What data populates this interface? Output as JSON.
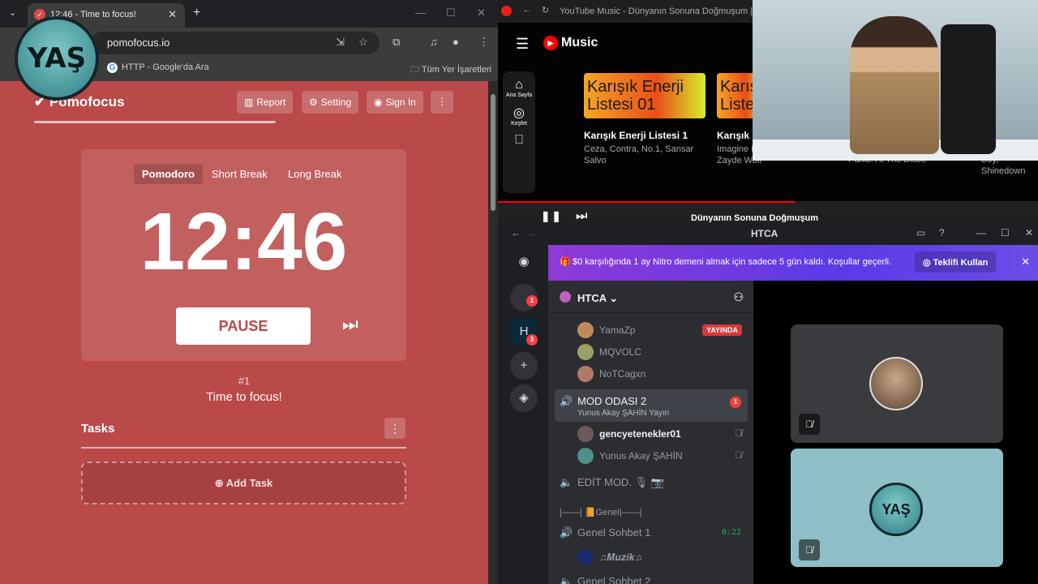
{
  "chrome": {
    "tab_title": "12:46 - Time to focus!",
    "url": "pomofocus.io",
    "bookmark_google": "HTTP - Google'da Ara",
    "bookmark_all": "Tüm Yer İşaretleri",
    "logo_text": "YAŞ"
  },
  "pomofocus": {
    "brand": "Pomofocus",
    "header_buttons": [
      {
        "label": "Report",
        "icon": "chart-icon"
      },
      {
        "label": "Setting",
        "icon": "gear-icon"
      },
      {
        "label": "Sign In",
        "icon": "user-icon"
      }
    ],
    "modes": [
      "Pomodoro",
      "Short Break",
      "Long Break"
    ],
    "active_mode": "Pomodoro",
    "timer": "12:46",
    "pause_label": "PAUSE",
    "round": "#1",
    "focus_text": "Time to focus!",
    "tasks_title": "Tasks",
    "add_task_label": "Add Task",
    "bg_color": "#ba4949"
  },
  "ytmusic": {
    "window_title": "YouTube Music - Dünyanın Sonuna Doğmuşum | YouT",
    "logo": "Music",
    "side_home": "Ana Sayfa",
    "side_explore": "Keşfet",
    "cards": [
      {
        "art_text": "Karışık Enerji Listesi",
        "num": "01",
        "title": "Karışık Enerji Listesi 1",
        "subtitle": "Ceza, Contra, No.1, Sansar Salvo"
      },
      {
        "art_text": "Karışık Listesi",
        "num": "",
        "title": "Karışık E",
        "subtitle": "Imagine Boy, Skillet, Zayde Wolf"
      }
    ],
    "extra_sub_1": "Panic! At The Disco",
    "extra_sub_2": "Boy, Shinedown",
    "now_playing": "Dünyanın Sonuna Doğmuşum",
    "progress_fraction": 0.55
  },
  "discord": {
    "window_title": "HTCA",
    "nitro_message": "$0 karşılığında 1 ay Nitro demeni almak için sadece 5 gün kaldı. Koşullar geçerli.",
    "nitro_button": "Teklifi Kullan",
    "server_name": "HTCA",
    "rail_badges": [
      "1",
      "3"
    ],
    "members_top": [
      {
        "name": "YamaZp",
        "live": "YAYINDA"
      },
      {
        "name": "MQVOLC"
      },
      {
        "name": "NoTCagxn"
      }
    ],
    "voice_selected": {
      "name": "MOD ODASI 2",
      "sub": "Yunus Akay ŞAHİN Yayın",
      "badge": "1"
    },
    "members_mod": [
      "gencyetenekler01",
      "Yunus Akay ŞAHİN"
    ],
    "edit_channel": "EDİT MOD. 🎙 📷",
    "category": "|——| 📙Genel|——|",
    "genel_sohbet_1": "Genel Sohbet 1",
    "genel_time": "0:22",
    "muzik_member": "♫𝑴𝒖𝒛𝒊𝒌♫",
    "genel_sohbet_2": "Genel Sohbet 2",
    "tile_logo": "YAŞ"
  }
}
